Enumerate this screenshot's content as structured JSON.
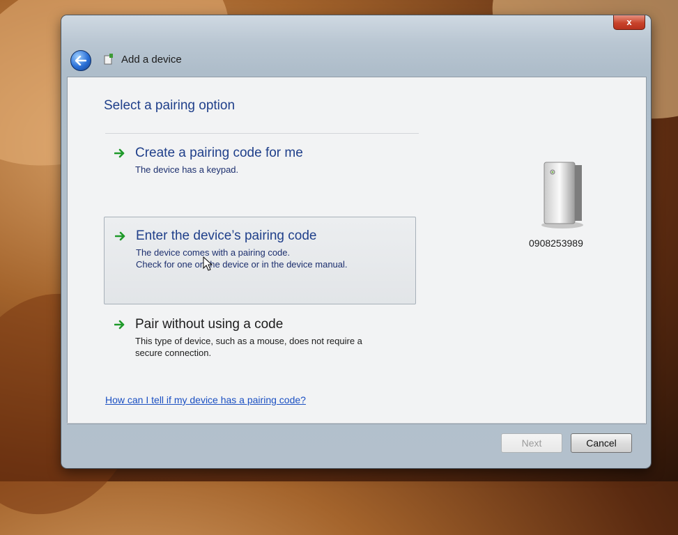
{
  "window": {
    "title": "Add a device",
    "close_label": "x"
  },
  "main": {
    "heading": "Select a pairing option",
    "options": [
      {
        "title": "Create a pairing code for me",
        "desc_lines": [
          "The device has a keypad."
        ]
      },
      {
        "title": "Enter the device’s pairing code",
        "desc_lines": [
          "The device comes with a pairing code.",
          "Check for one on the device or in the device manual."
        ]
      },
      {
        "title": "Pair without using a code",
        "desc_lines": [
          "This type of device, such as a mouse, does not require a",
          "secure connection."
        ]
      }
    ],
    "help_link": "How can I tell if my device has a pairing code?"
  },
  "device": {
    "name": "0908253989",
    "icon": "device-tower-icon"
  },
  "footer": {
    "next_label": "Next",
    "cancel_label": "Cancel"
  },
  "colors": {
    "accent_text": "#1f3f8a",
    "arrow_green": "#1f9a2a",
    "link": "#1a4fc2"
  }
}
